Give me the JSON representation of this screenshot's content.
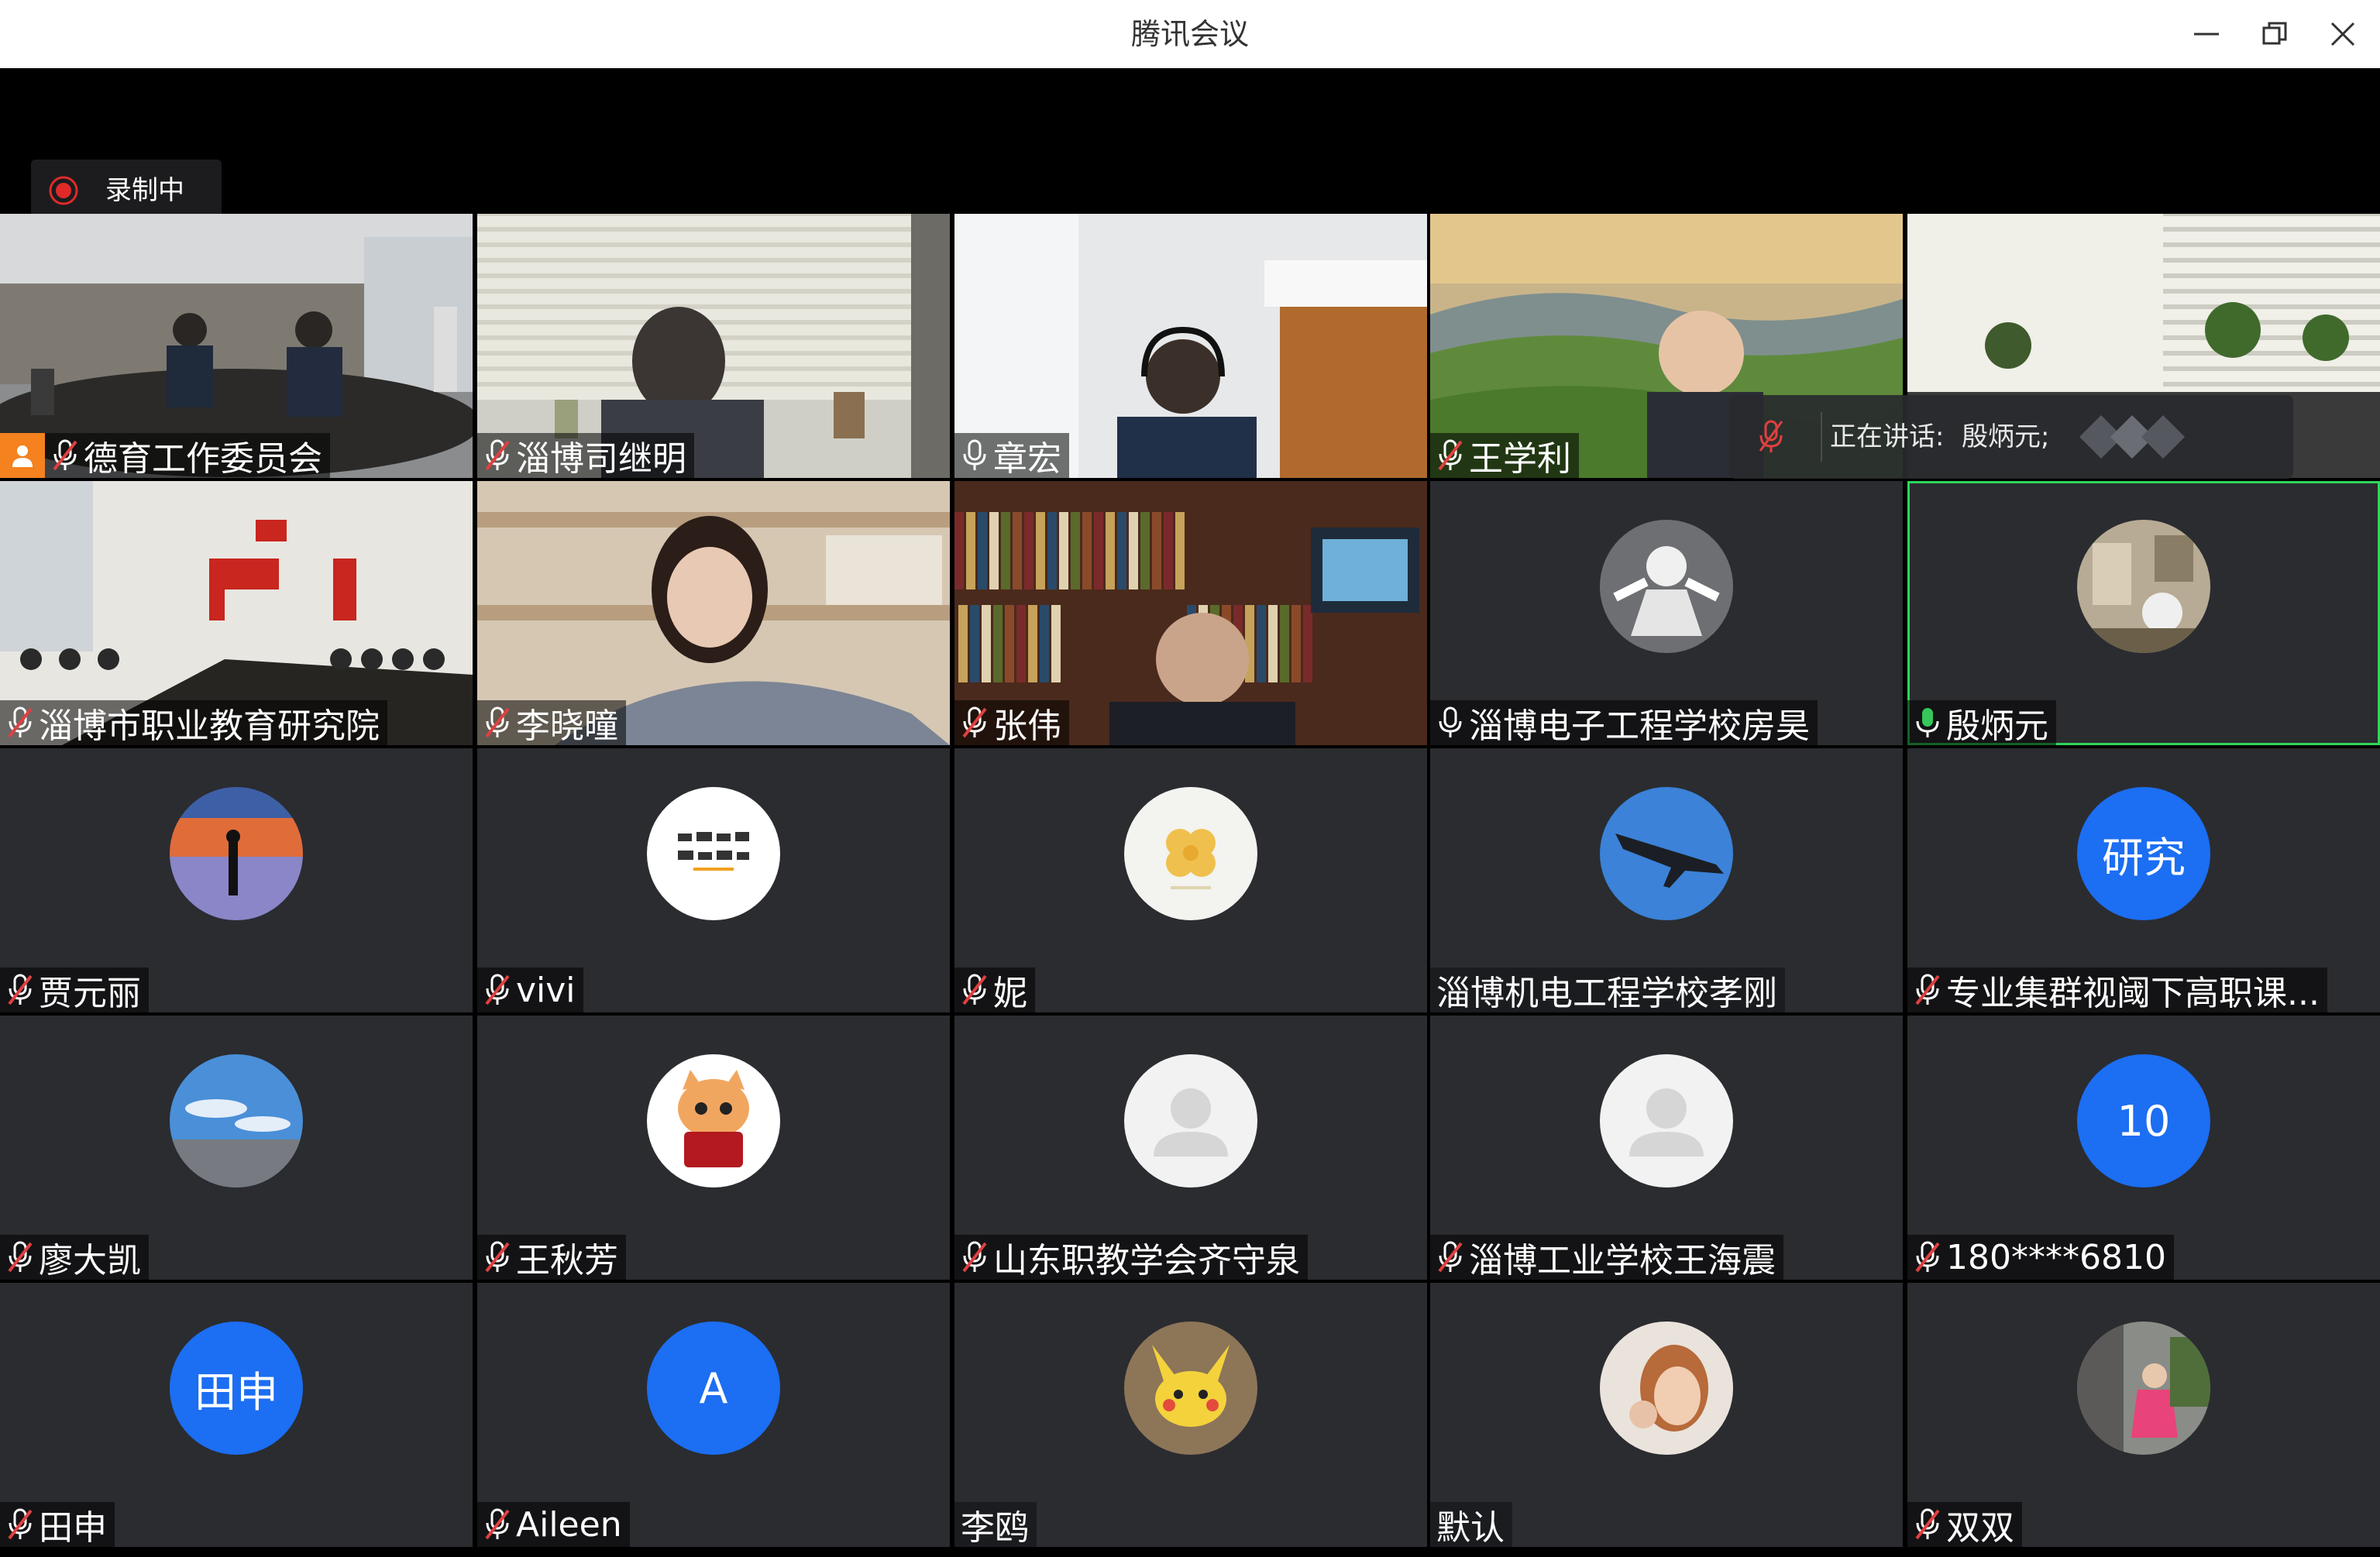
{
  "window": {
    "title": "腾讯会议",
    "minimize_label": "—",
    "restore_label": "❐",
    "close_label": "✕"
  },
  "recording": {
    "label": "录制中",
    "accent": "#e02a2a"
  },
  "speaking": {
    "label": "正在讲话:",
    "name": "殷炳元;"
  },
  "colors": {
    "tile_bg": "#2a2c30",
    "avatar_blue": "#1c6ef2",
    "active_border": "#2fd65a",
    "mic_muted": "#e04040",
    "mic_active": "#35c759",
    "host_orange": "#f5811f"
  },
  "participants": [
    {
      "name": "德育工作委员会",
      "mic": "muted",
      "host": true,
      "kind": "video"
    },
    {
      "name": "淄博司继明",
      "mic": "muted",
      "kind": "video"
    },
    {
      "name": "章宏",
      "mic": "on",
      "kind": "video"
    },
    {
      "name": "王学利",
      "mic": "muted",
      "kind": "video"
    },
    {
      "name": "",
      "mic": "none",
      "kind": "video"
    },
    {
      "name": "淄博市职业教育研究院",
      "mic": "muted",
      "kind": "video"
    },
    {
      "name": "李晓曈",
      "mic": "muted",
      "kind": "video"
    },
    {
      "name": "张伟",
      "mic": "muted",
      "kind": "video"
    },
    {
      "name": "淄博电子工程学校房昊",
      "mic": "on",
      "kind": "avatar",
      "avatar": "figure-photo-icon"
    },
    {
      "name": "殷炳元",
      "mic": "speaking",
      "kind": "avatar",
      "avatar": "room-photo-icon",
      "active": true
    },
    {
      "name": "贾元丽",
      "mic": "muted",
      "kind": "avatar",
      "avatar": "sunset-photo-icon"
    },
    {
      "name": "vivi",
      "mic": "muted",
      "kind": "avatar",
      "avatar": "calligraphy-icon"
    },
    {
      "name": "妮",
      "mic": "muted",
      "kind": "avatar",
      "avatar": "clover-icon"
    },
    {
      "name": "淄博机电工程学校孝刚",
      "mic": "none",
      "kind": "avatar",
      "avatar": "jet-icon"
    },
    {
      "name": "专业集群视阈下高职课...",
      "mic": "muted",
      "kind": "avatar",
      "avatar_text": "研究"
    },
    {
      "name": "廖大凯",
      "mic": "muted",
      "kind": "avatar",
      "avatar": "sky-photo-icon"
    },
    {
      "name": "王秋芳",
      "mic": "muted",
      "kind": "avatar",
      "avatar": "cat-icon"
    },
    {
      "name": "山东职教学会齐守泉",
      "mic": "muted",
      "kind": "avatar",
      "avatar": "default-user-icon"
    },
    {
      "name": "淄博工业学校王海震",
      "mic": "muted",
      "kind": "avatar",
      "avatar": "default-user-icon"
    },
    {
      "name": "180****6810",
      "mic": "muted",
      "kind": "avatar",
      "avatar_text": "10"
    },
    {
      "name": "田申",
      "mic": "muted",
      "kind": "avatar",
      "avatar_text": "田申"
    },
    {
      "name": "Aileen",
      "mic": "muted",
      "kind": "avatar",
      "avatar_text": "A"
    },
    {
      "name": "李鸥",
      "mic": "none",
      "kind": "avatar",
      "avatar": "pikachu-icon"
    },
    {
      "name": "默认",
      "mic": "none",
      "kind": "avatar",
      "avatar": "portrait-photo-icon"
    },
    {
      "name": "双双",
      "mic": "muted",
      "kind": "avatar",
      "avatar": "outdoor-photo-icon"
    }
  ]
}
